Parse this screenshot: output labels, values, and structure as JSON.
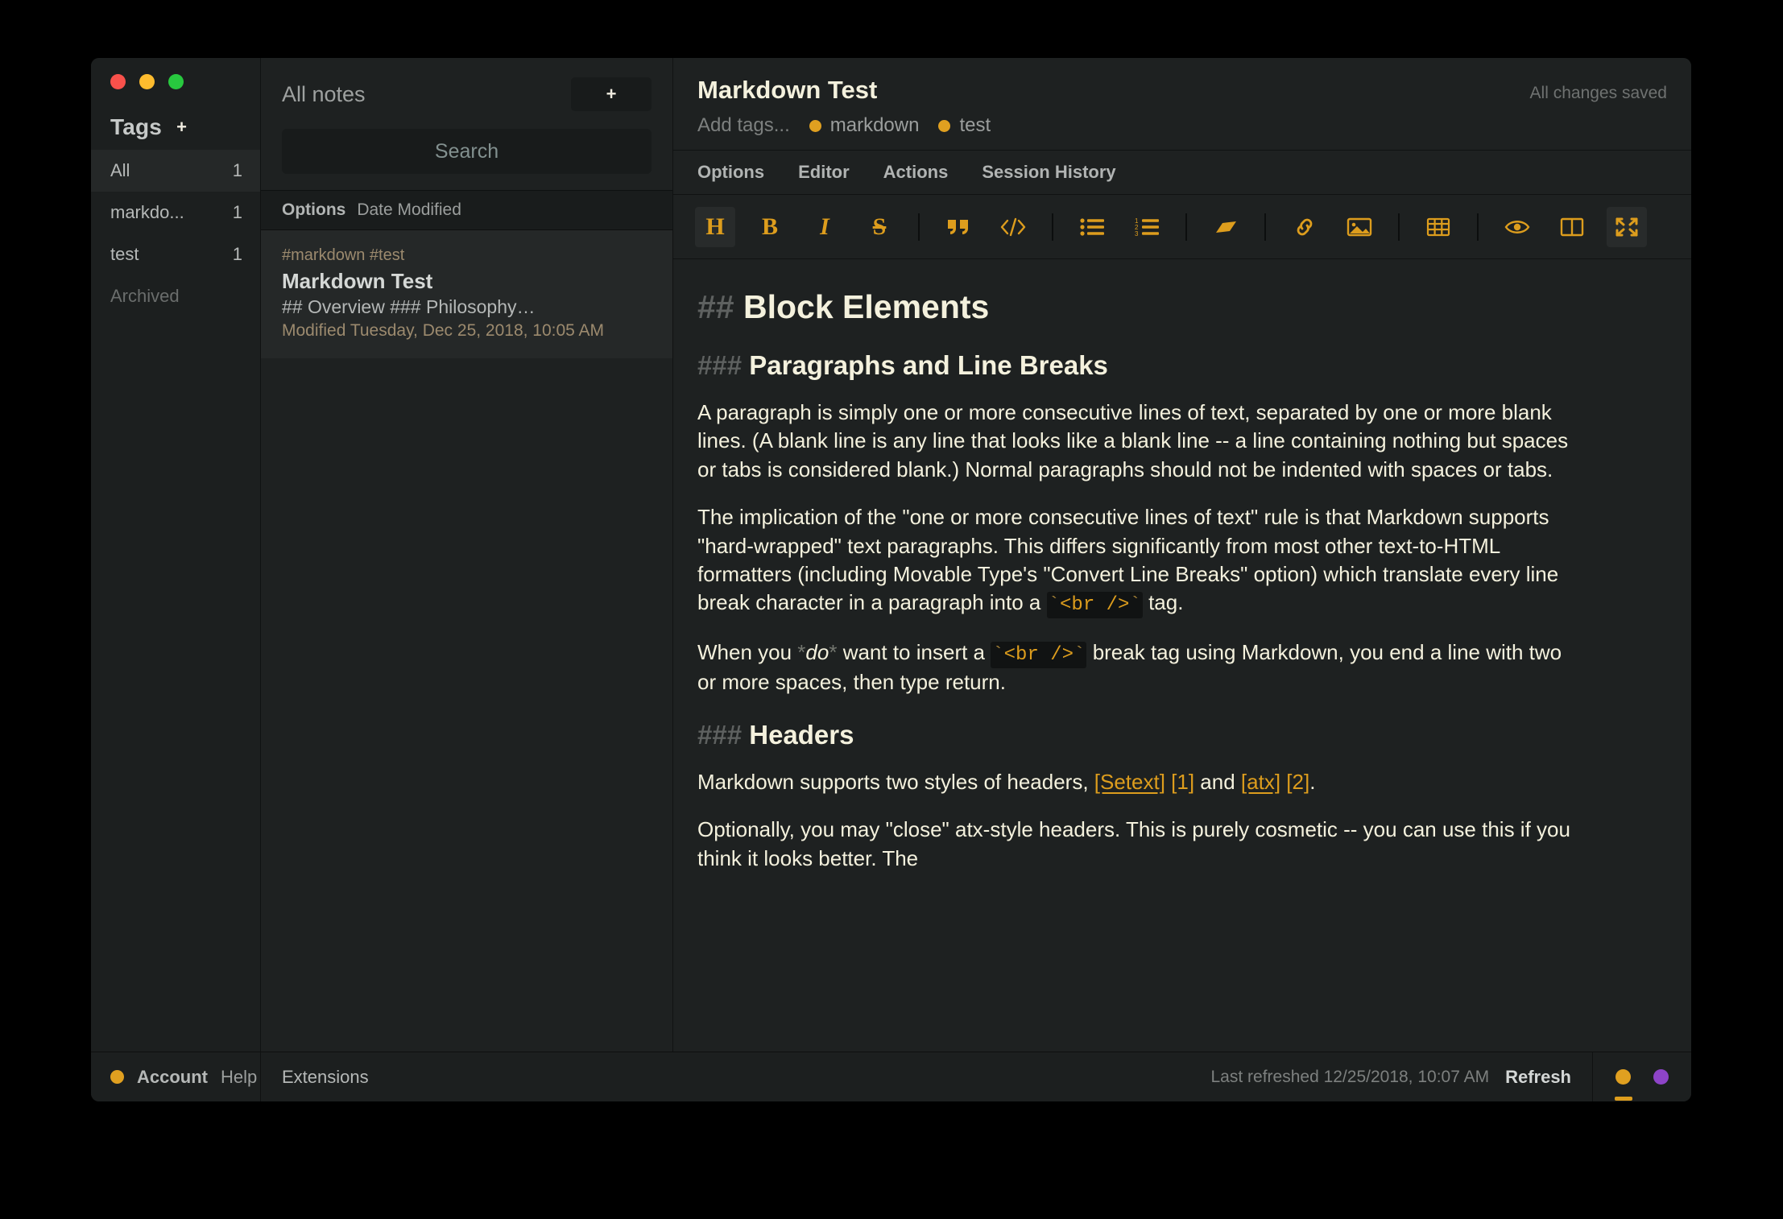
{
  "window": {
    "traffic_lights": [
      "close",
      "minimize",
      "maximize"
    ]
  },
  "sidebar": {
    "title": "Tags",
    "add_tag_label": "+",
    "items": [
      {
        "label": "All",
        "count": "1",
        "selected": true
      },
      {
        "label": "markdo...",
        "count": "1",
        "selected": false
      },
      {
        "label": "test",
        "count": "1",
        "selected": false
      },
      {
        "label": "Archived",
        "count": "",
        "selected": false
      }
    ]
  },
  "notes_panel": {
    "title": "All notes",
    "new_note_label": "+",
    "search_placeholder": "Search",
    "options_label": "Options",
    "sort_label": "Date Modified",
    "notes": [
      {
        "tags": "#markdown #test",
        "title": "Markdown Test",
        "excerpt": "## Overview ### Philosophy…",
        "modified": "Modified Tuesday, Dec 25, 2018, 10:05 AM"
      }
    ]
  },
  "editor": {
    "note_title": "Markdown Test",
    "save_status": "All changes saved",
    "add_tags_placeholder": "Add tags...",
    "tags": [
      {
        "label": "markdown",
        "color": "#e0a020"
      },
      {
        "label": "test",
        "color": "#e0a020"
      }
    ],
    "menu": [
      {
        "label": "Options"
      },
      {
        "label": "Editor"
      },
      {
        "label": "Actions"
      },
      {
        "label": "Session History"
      }
    ],
    "toolbar": [
      {
        "icon": "heading-icon",
        "glyph": "H",
        "active": true
      },
      {
        "icon": "bold-icon",
        "glyph": "B",
        "active": false
      },
      {
        "icon": "italic-icon",
        "glyph": "I",
        "active": false
      },
      {
        "icon": "strikethrough-icon",
        "glyph": "S",
        "active": false
      },
      {
        "icon": "separator"
      },
      {
        "icon": "blockquote-icon",
        "active": false
      },
      {
        "icon": "code-icon",
        "active": false
      },
      {
        "icon": "separator"
      },
      {
        "icon": "bullet-list-icon",
        "active": false
      },
      {
        "icon": "numbered-list-icon",
        "active": false
      },
      {
        "icon": "separator"
      },
      {
        "icon": "highlighter-icon",
        "active": false
      },
      {
        "icon": "separator"
      },
      {
        "icon": "link-icon",
        "active": false
      },
      {
        "icon": "image-icon",
        "active": false
      },
      {
        "icon": "separator"
      },
      {
        "icon": "table-icon",
        "active": false
      },
      {
        "icon": "separator"
      },
      {
        "icon": "preview-eye-icon",
        "active": false
      },
      {
        "icon": "split-view-icon",
        "active": false
      },
      {
        "icon": "fullscreen-icon",
        "active": true
      }
    ],
    "accent_color": "#dd9d1d",
    "content": {
      "h2_marker": "##",
      "h2_text": "Block Elements",
      "h3a_marker": "###",
      "h3a_text": "Paragraphs and Line Breaks",
      "p1": "A paragraph is simply one or more consecutive lines of text, separated by one or more blank lines. (A blank line is any line that looks like a blank line -- a line containing nothing but spaces or tabs is considered blank.) Normal paragraphs should not be indented with spaces or tabs.",
      "p2_a": "The implication of the \"one or more consecutive lines of text\" rule is that Markdown supports \"hard-wrapped\" text paragraphs. This differs significantly from most other text-to-HTML formatters (including Movable Type's \"Convert Line Breaks\" option) which translate every line break character in a paragraph into a ",
      "p2_code": "<br />",
      "p2_b": " tag.",
      "p3_a": "When you ",
      "p3_star1": "*",
      "p3_em": "do",
      "p3_star2": "*",
      "p3_b": " want to insert a ",
      "p3_code": "<br />",
      "p3_c": " break tag using Markdown, you end a line with two or more spaces, then type return.",
      "h3b_marker": "###",
      "h3b_text": "Headers",
      "p4_a": "Markdown supports two styles of headers, ",
      "p4_link1": "[Setext]",
      "p4_ref1": " [1]",
      "p4_mid": " and ",
      "p4_link2": "[atx]",
      "p4_ref2": " [2]",
      "p4_end": ".",
      "p5": "Optionally, you may \"close\" atx-style headers. This is purely cosmetic -- you can use this if you think it looks better. The"
    }
  },
  "status_bar": {
    "account_label": "Account",
    "help_label": "Help",
    "extensions_label": "Extensions",
    "last_refreshed": "Last refreshed 12/25/2018, 10:07 AM",
    "refresh_label": "Refresh",
    "indicators": [
      {
        "name": "amber-indicator",
        "color": "#e0a020",
        "has_bar": true,
        "bar_color": "#dd9d1d"
      },
      {
        "name": "purple-indicator",
        "color": "#8e44c8",
        "has_bar": false
      }
    ]
  }
}
